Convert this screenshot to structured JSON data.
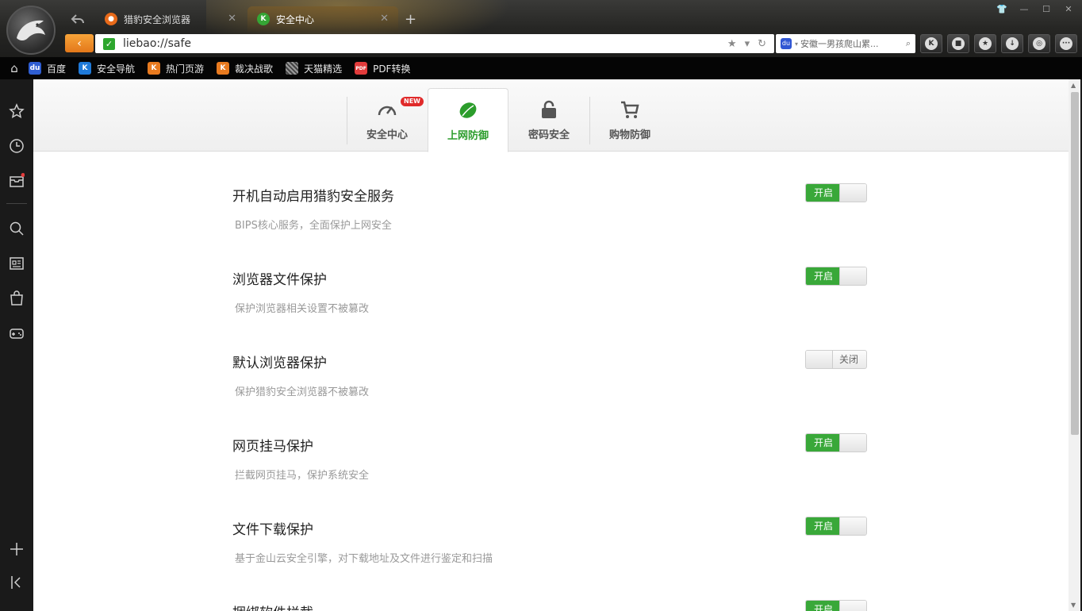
{
  "tabs": [
    {
      "title": "猎豹安全浏览器"
    },
    {
      "title": "安全中心"
    }
  ],
  "address": {
    "url": "liebao://safe"
  },
  "search": {
    "text": "安徽一男孩爬山累..."
  },
  "bookmarks": [
    {
      "label": "百度",
      "color": "#2f5ed1"
    },
    {
      "label": "安全导航",
      "color": "#1f7ad9"
    },
    {
      "label": "热门页游",
      "color": "#e87a1f"
    },
    {
      "label": "裁决战歌",
      "color": "#e87a1f"
    },
    {
      "label": "天猫精选",
      "color": "#888888"
    },
    {
      "label": "PDF转换",
      "color": "#e23b3b"
    }
  ],
  "subtabs": [
    {
      "label": "安全中心",
      "badge": "NEW"
    },
    {
      "label": "上网防御"
    },
    {
      "label": "密码安全"
    },
    {
      "label": "购物防御"
    }
  ],
  "settings": [
    {
      "title": "开机自动启用猎豹安全服务",
      "desc": "BIPS核心服务，全面保护上网安全",
      "state": "开启"
    },
    {
      "title": "浏览器文件保护",
      "desc": "保护浏览器相关设置不被篡改",
      "state": "开启"
    },
    {
      "title": "默认浏览器保护",
      "desc": "保护猎豹安全浏览器不被篡改",
      "state": "关闭"
    },
    {
      "title": "网页挂马保护",
      "desc": "拦截网页挂马，保护系统安全",
      "state": "开启"
    },
    {
      "title": "文件下载保护",
      "desc": "基于金山云安全引擎，对下载地址及文件进行鉴定和扫描",
      "state": "开启"
    },
    {
      "title": "捆绑软件拦截",
      "desc": "",
      "state": "开启"
    }
  ],
  "colors": {
    "accent_green": "#39a839",
    "back_orange": "#f08c28"
  }
}
